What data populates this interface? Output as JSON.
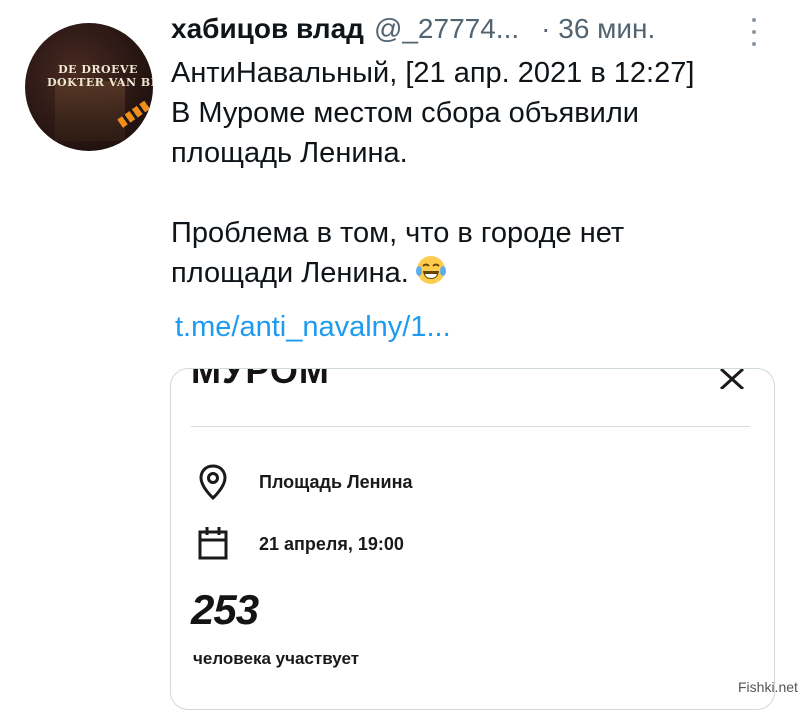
{
  "tweet": {
    "author_name": "хабицов влад",
    "handle": "@_27774...",
    "time": "· 36 мин.",
    "lines": [
      "АнтиНавальный, [21 апр. 2021 в 12:27]",
      "В Муроме местом сбора объявили",
      "площадь Ленина."
    ],
    "lines2": [
      "Проблема в том, что в городе нет",
      "площади Ленина."
    ],
    "link": "t.me/anti_navalny/1..."
  },
  "avatar": {
    "line1": "DE DROEVE",
    "line2": "DOKTER VAN BES"
  },
  "card": {
    "title": "МУРОМ",
    "place": "Площадь Ленина",
    "date": "21 апреля, 19:00",
    "count": "253",
    "count_label": "человека участвует"
  },
  "watermark": "Fishki.net",
  "colors": {
    "link": "#1d9bf0",
    "secondary_text": "#536471",
    "card_border": "#cfd9de"
  },
  "icons": {
    "more": "more-icon",
    "emoji": "crying-laughing-emoji-icon",
    "close": "close-icon",
    "location": "location-pin-icon",
    "calendar": "calendar-icon"
  }
}
